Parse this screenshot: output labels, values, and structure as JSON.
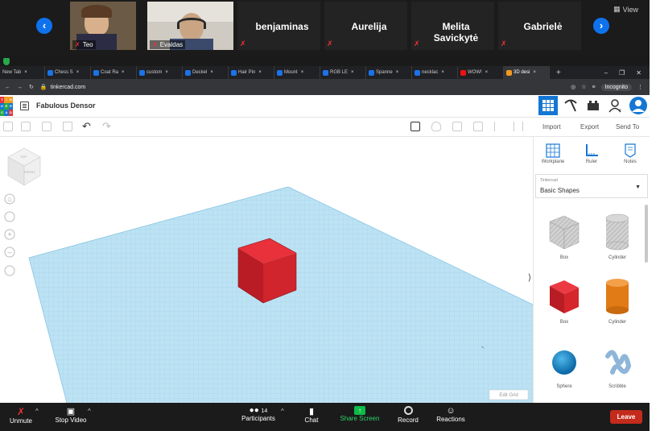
{
  "zoom_top": {
    "participants": [
      {
        "name": "Teo",
        "type": "video"
      },
      {
        "name": "Evaldas",
        "type": "video"
      },
      {
        "name": "benjaminas",
        "type": "name"
      },
      {
        "name": "Aurelija",
        "type": "name"
      },
      {
        "name": "Melita Savickytė",
        "type": "name"
      },
      {
        "name": "Gabrielė",
        "type": "name"
      }
    ],
    "view_label": "View"
  },
  "browser": {
    "tabs": [
      {
        "label": "New Tab",
        "active": false
      },
      {
        "label": "Chess S",
        "active": false
      },
      {
        "label": "Coat Ra",
        "active": false
      },
      {
        "label": "custom",
        "active": false
      },
      {
        "label": "Deckel",
        "active": false
      },
      {
        "label": "Hair Pin",
        "active": false
      },
      {
        "label": "Mount",
        "active": false
      },
      {
        "label": "RGB LE",
        "active": false
      },
      {
        "label": "Spanne",
        "active": false
      },
      {
        "label": "necklac",
        "active": false
      },
      {
        "label": "WOW!",
        "active": false
      },
      {
        "label": "3D desi",
        "active": true
      }
    ],
    "new_tab": "+",
    "url": "tinkercad.com",
    "incognito_label": "Incognito"
  },
  "tinkercad": {
    "logo_letters": [
      "T",
      "I",
      "N",
      "K",
      "E",
      "R",
      "C",
      "A",
      "D"
    ],
    "design_title": "Fabulous Densor",
    "import_label": "Import",
    "export_label": "Export",
    "send_to_label": "Send To",
    "view_cube_top": "TOP",
    "view_cube_front": "FRONT",
    "edit_grid_label": "Edit Grid",
    "panel_tools": [
      {
        "label": "Workplane",
        "icon": "workplane-icon"
      },
      {
        "label": "Ruler",
        "icon": "ruler-icon"
      },
      {
        "label": "Notes",
        "icon": "notes-icon"
      }
    ],
    "library_caption": "Tinkercad",
    "library_selected": "Basic Shapes",
    "shapes": [
      {
        "label": "Box",
        "style": "hole",
        "color": "#b8b8b8"
      },
      {
        "label": "Cylinder",
        "style": "hole",
        "color": "#b8b8b8"
      },
      {
        "label": "Box",
        "style": "solid",
        "color": "#d8232a"
      },
      {
        "label": "Cylinder",
        "style": "solid",
        "color": "#e07b16"
      },
      {
        "label": "Sphere",
        "style": "solid",
        "color": "#1689c9"
      },
      {
        "label": "Scribble",
        "style": "solid",
        "color": "#8fb6d9"
      }
    ]
  },
  "zoom_bottom": {
    "unmute": "Unmute",
    "stop_video": "Stop Video",
    "participants_label": "Participants",
    "participants_count": "14",
    "chat": "Chat",
    "share_screen": "Share Screen",
    "record": "Record",
    "reactions": "Reactions",
    "leave": "Leave"
  },
  "colors": {
    "zoom_blue": "#0e72ed",
    "share_green": "#0fbb49",
    "leave_red": "#c42b1c",
    "tinkercad_blue": "#1477d4",
    "grid_blue": "#a9d7ee",
    "cube_red": "#d8232a"
  }
}
